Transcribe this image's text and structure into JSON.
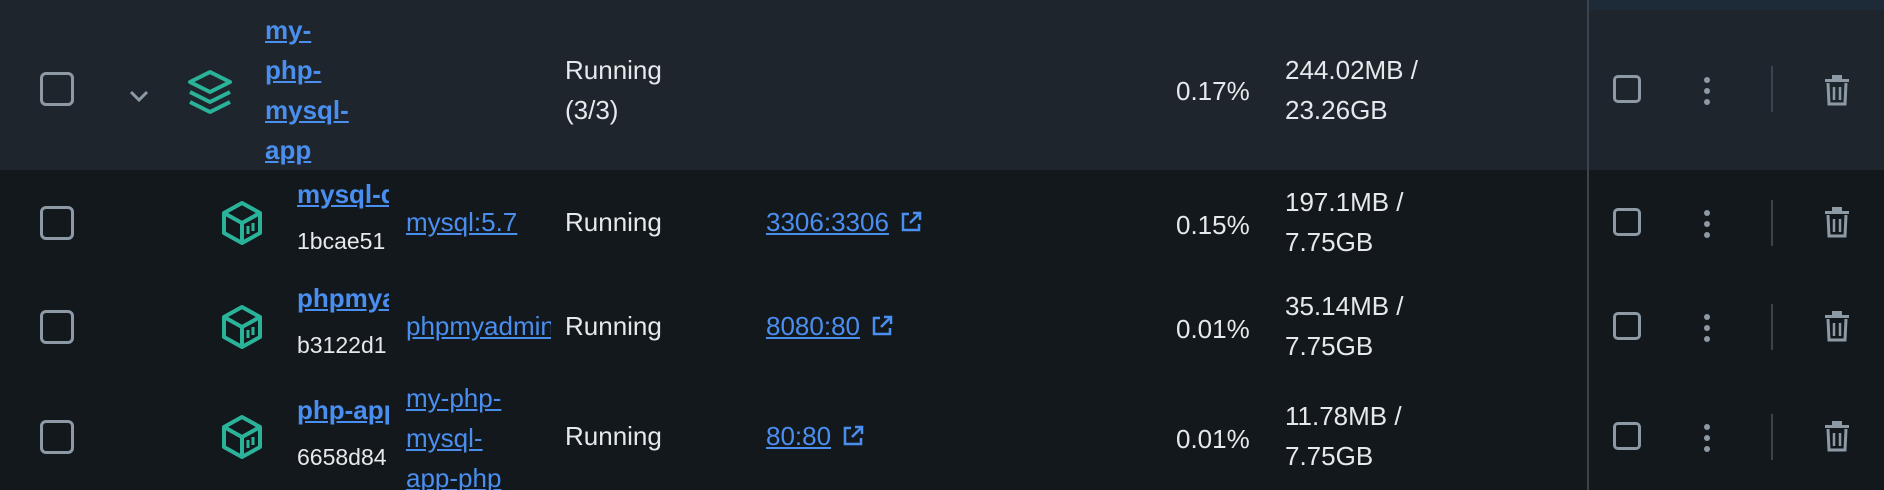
{
  "group": {
    "name": "my-php-mysql-app",
    "status": "Running (3/3)",
    "cpu": "0.17%",
    "memory": "244.02MB / 23.26GB"
  },
  "containers": [
    {
      "name": "mysql-db",
      "id": "1bcae51",
      "image": "mysql:5.7",
      "status": "Running",
      "port": "3306:3306",
      "cpu": "0.15%",
      "memory": "197.1MB / 7.75GB"
    },
    {
      "name": "phpmyadmin",
      "id": "b3122d1",
      "image": "phpmyadmin",
      "status": "Running",
      "port": "8080:80",
      "cpu": "0.01%",
      "memory": "35.14MB / 7.75GB"
    },
    {
      "name": "php-app",
      "id": "6658d84",
      "image": "my-php-mysql-app-php",
      "status": "Running",
      "port": "80:80",
      "cpu": "0.01%",
      "memory": "11.78MB / 7.75GB"
    }
  ],
  "colors": {
    "accent_link": "#4a8ff0",
    "icon_teal": "#2bb39a",
    "background": "#13181d",
    "group_row": "#1e252c"
  },
  "icons": [
    "chevron-down-icon",
    "stack-icon",
    "container-icon",
    "external-link-icon",
    "kebab-menu-icon",
    "trash-icon"
  ]
}
